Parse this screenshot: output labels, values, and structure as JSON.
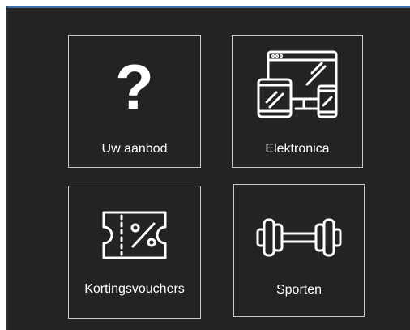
{
  "tiles": [
    {
      "label": "Uw aanbod",
      "icon": "question-mark-icon"
    },
    {
      "label": "Elektronica",
      "icon": "devices-icon"
    },
    {
      "label": "Kortingsvouchers",
      "icon": "voucher-icon"
    },
    {
      "label": "Sporten",
      "icon": "dumbbell-icon"
    }
  ],
  "question_glyph": "?",
  "colors": {
    "panel_background": "#232323",
    "tile_border": "#c9c9c9",
    "text": "#ffffff",
    "top_accent": "#3d6fa8"
  }
}
